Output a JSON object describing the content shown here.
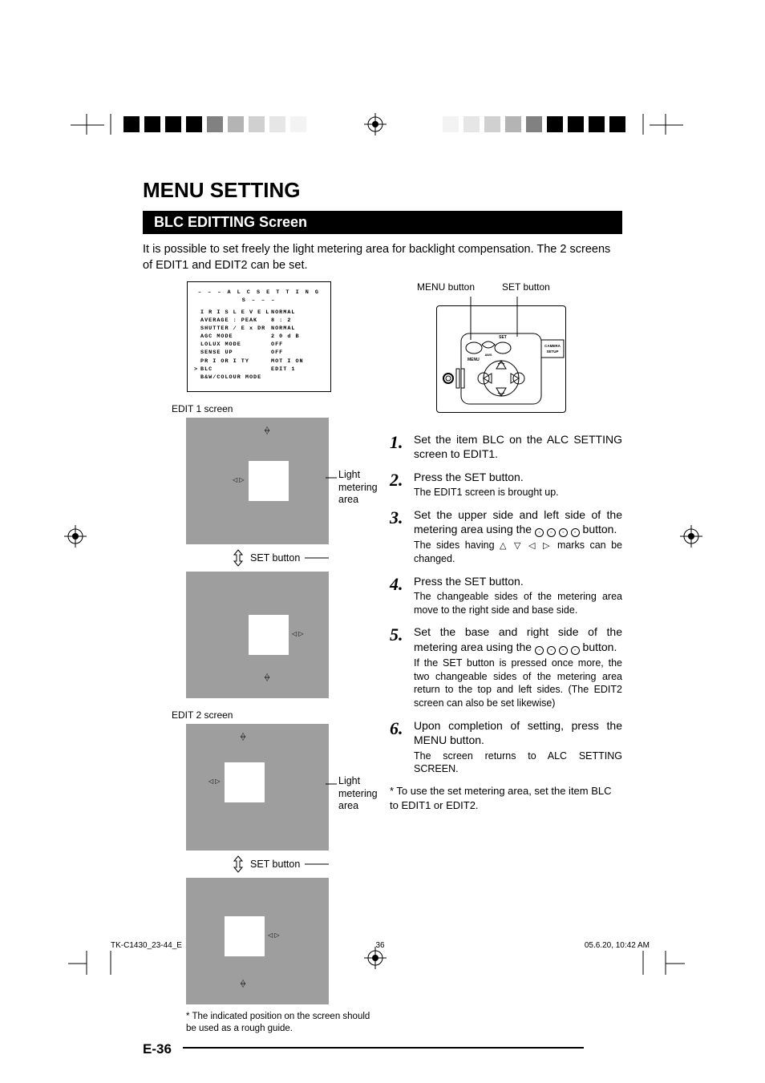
{
  "header": {
    "title": "MENU SETTING",
    "subtitle": "BLC EDITTING Screen"
  },
  "intro": "It is possible to set freely the light metering area for backlight compensation.  The 2 screens of EDIT1 and EDIT2 can be set.",
  "alc": {
    "title": "– – –   A L C   S E T T I N G S   – – –",
    "rows": [
      {
        "k": "I R I S   L E V E L",
        "v": "NORMAL"
      },
      {
        "k": "AVERAGE : PEAK",
        "v": "8 : 2"
      },
      {
        "k": "SHUTTER / E x DR",
        "v": "NORMAL"
      },
      {
        "k": "AGC   MODE",
        "v": "2 0 d B"
      },
      {
        "k": "LOLUX   MODE",
        "v": "OFF"
      },
      {
        "k": "SENSE   UP",
        "v": "OFF"
      },
      {
        "k": "PR I OR I TY",
        "v": "MOT I ON"
      },
      {
        "k": "BLC",
        "v": "EDIT 1",
        "cursor": true
      },
      {
        "k": "B&W/COLOUR MODE",
        "v": ""
      }
    ]
  },
  "labels": {
    "edit1": "EDIT 1 screen",
    "edit2": "EDIT 2 screen",
    "lightMetering": "Light metering area",
    "setButton": "SET button",
    "menuButton": "MENU button",
    "cameraSetup": "CAMERA SETUP",
    "set": "SET",
    "aws": "AWS",
    "menu": "MENU"
  },
  "footnote": "*  The indicated position on the screen should be used as a rough guide.",
  "steps": [
    {
      "n": "1.",
      "main": "Set the item BLC on the ALC SETTING screen to EDIT1.",
      "sub": ""
    },
    {
      "n": "2.",
      "main": "Press the SET button.",
      "sub": "The EDIT1 screen is brought up."
    },
    {
      "n": "3.",
      "main": "Set the upper side and left side of the metering area using the ⊚ ⊚ ⊚ ⊚ button.",
      "sub": "The sides having △ ▽ ◁ ▷ marks can be changed."
    },
    {
      "n": "4.",
      "main": "Press the SET button.",
      "sub": "The changeable sides of the metering area move to the right side and base side."
    },
    {
      "n": "5.",
      "main": "Set the base and right side of the metering area using the ⊚ ⊚ ⊚ ⊚ button.",
      "sub": "If the SET button is pressed once more, the two changeable sides of the metering area return to the top and left sides. (The EDIT2 screen can also be set likewise)"
    },
    {
      "n": "6.",
      "main": "Upon completion of setting, press the MENU button.",
      "sub": "The screen returns to ALC SETTING SCREEN."
    }
  ],
  "postnote": "* To use the set metering area, set the item BLC to EDIT1 or EDIT2.",
  "page": "E-36",
  "footer": {
    "file": "TK-C1430_23-44_E",
    "pg": "36",
    "ts": "05.6.20, 10:42 AM"
  }
}
